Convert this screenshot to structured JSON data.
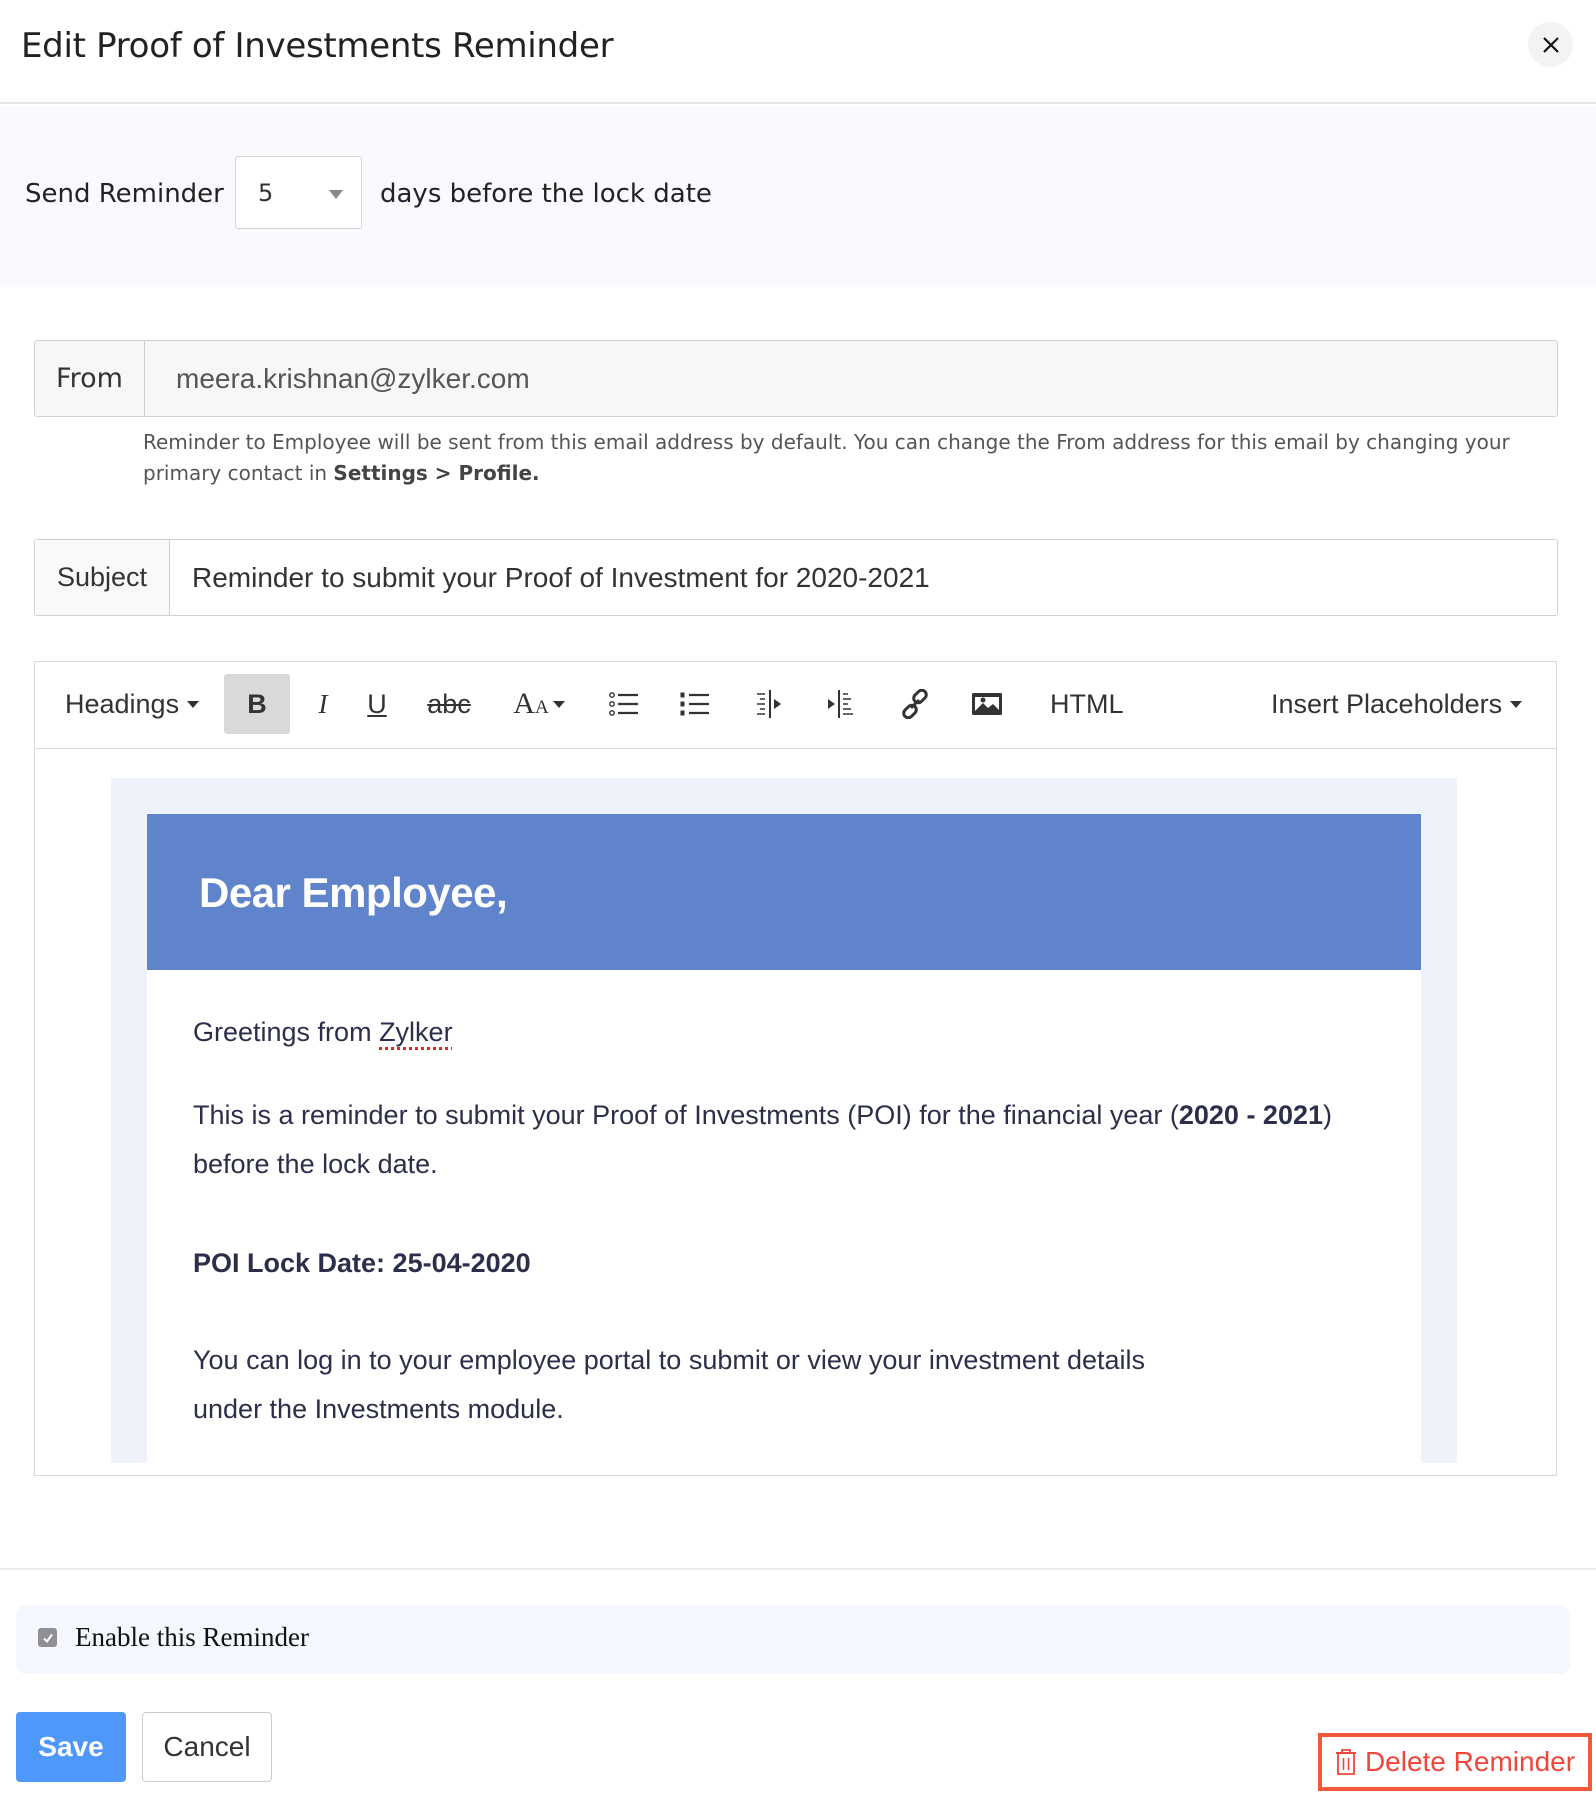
{
  "header": {
    "title": "Edit Proof of Investments Reminder",
    "close_icon": "close-icon"
  },
  "send_reminder": {
    "label": "Send Reminder",
    "days_value": "5",
    "suffix": "days before the lock date"
  },
  "from": {
    "label": "From",
    "value": "meera.krishnan@zylker.com",
    "helper_text": "Reminder to Employee will be sent from this email address by default. You can change the From address for this email by changing your primary contact in ",
    "helper_bold": "Settings > Profile."
  },
  "subject": {
    "label": "Subject",
    "value": "Reminder to submit your Proof of Investment for 2020-2021"
  },
  "toolbar": {
    "headings": "Headings",
    "bold": "B",
    "italic": "I",
    "underline": "U",
    "strikethrough": "abc",
    "font_size": "A",
    "font_size_small": "A",
    "html": "HTML",
    "insert_placeholders": "Insert Placeholders",
    "icons": [
      "bulleted-list-icon",
      "numbered-list-icon",
      "outdent-icon",
      "indent-icon",
      "link-icon",
      "image-icon"
    ]
  },
  "email": {
    "heading": "Dear Employee,",
    "greeting_prefix": "Greetings from ",
    "greeting_company": "Zylker",
    "para2_text": "This is a reminder to submit your Proof of Investments (POI) for the financial year (",
    "para2_bold": "2020 - 2021",
    "para2_close": ")",
    "para2_line2": "before the lock date.",
    "lock_date": "POI Lock Date: 25-04-2020",
    "para4": "You can log in to your employee portal to submit or view your investment details under the Investments module.",
    "header_color": "#5f84cb"
  },
  "footer": {
    "enable_label": "Enable this Reminder",
    "enable_checked": true,
    "save": "Save",
    "cancel": "Cancel",
    "delete": "Delete Reminder",
    "save_color": "#4f97f8",
    "delete_color": "#f0473a"
  }
}
